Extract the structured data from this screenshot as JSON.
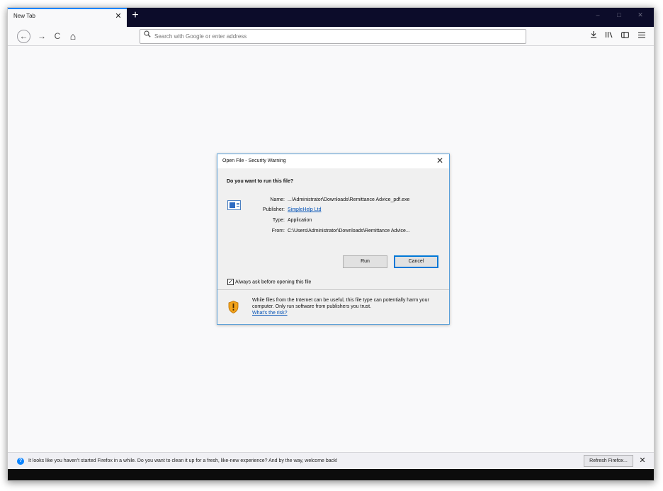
{
  "browser": {
    "tab_title": "New Tab",
    "tab_close": "✕",
    "new_tab": "+",
    "window_controls": {
      "minimize": "–",
      "maximize": "□",
      "close": "✕"
    },
    "nav": {
      "back": "←",
      "forward": "→",
      "reload": "C",
      "home": "⌂"
    },
    "search": {
      "placeholder": "Search with Google or enter address",
      "value": "",
      "icon": "search-icon"
    },
    "toolbar": {
      "downloads": "⭳",
      "library": "|||\\",
      "sidebar": "◫",
      "menu": "≡"
    }
  },
  "dialog": {
    "title": "Open File - Security Warning",
    "close": "✕",
    "question": "Do you want to run this file?",
    "fields": {
      "name_label": "Name:",
      "name_value": "...\\Administrator\\Downloads\\Remittance Advice_pdf.exe",
      "publisher_label": "Publisher:",
      "publisher_value": "SimpleHelp Ltd",
      "type_label": "Type:",
      "type_value": "Application",
      "from_label": "From:",
      "from_value": "C:\\Users\\Administrator\\Downloads\\Remittance Advice..."
    },
    "run_label": "Run",
    "cancel_label": "Cancel",
    "checkbox_label": "Always ask before opening this file",
    "checkbox_checked": true,
    "warning_text": "While files from the Internet can be useful, this file type can potentially harm your computer. Only run software from publishers you trust.",
    "warning_link": "What's the risk?"
  },
  "notification": {
    "text": "It looks like you haven't started Firefox in a while. Do you want to clean it up for a fresh, like-new experience? And by the way, welcome back!",
    "button_label": "Refresh Firefox...",
    "close": "✕"
  },
  "colors": {
    "accent": "#0a84ff",
    "tabstrip": "#0c0c2a",
    "dialog_border": "#5aa0d8",
    "link": "#0050b5"
  }
}
